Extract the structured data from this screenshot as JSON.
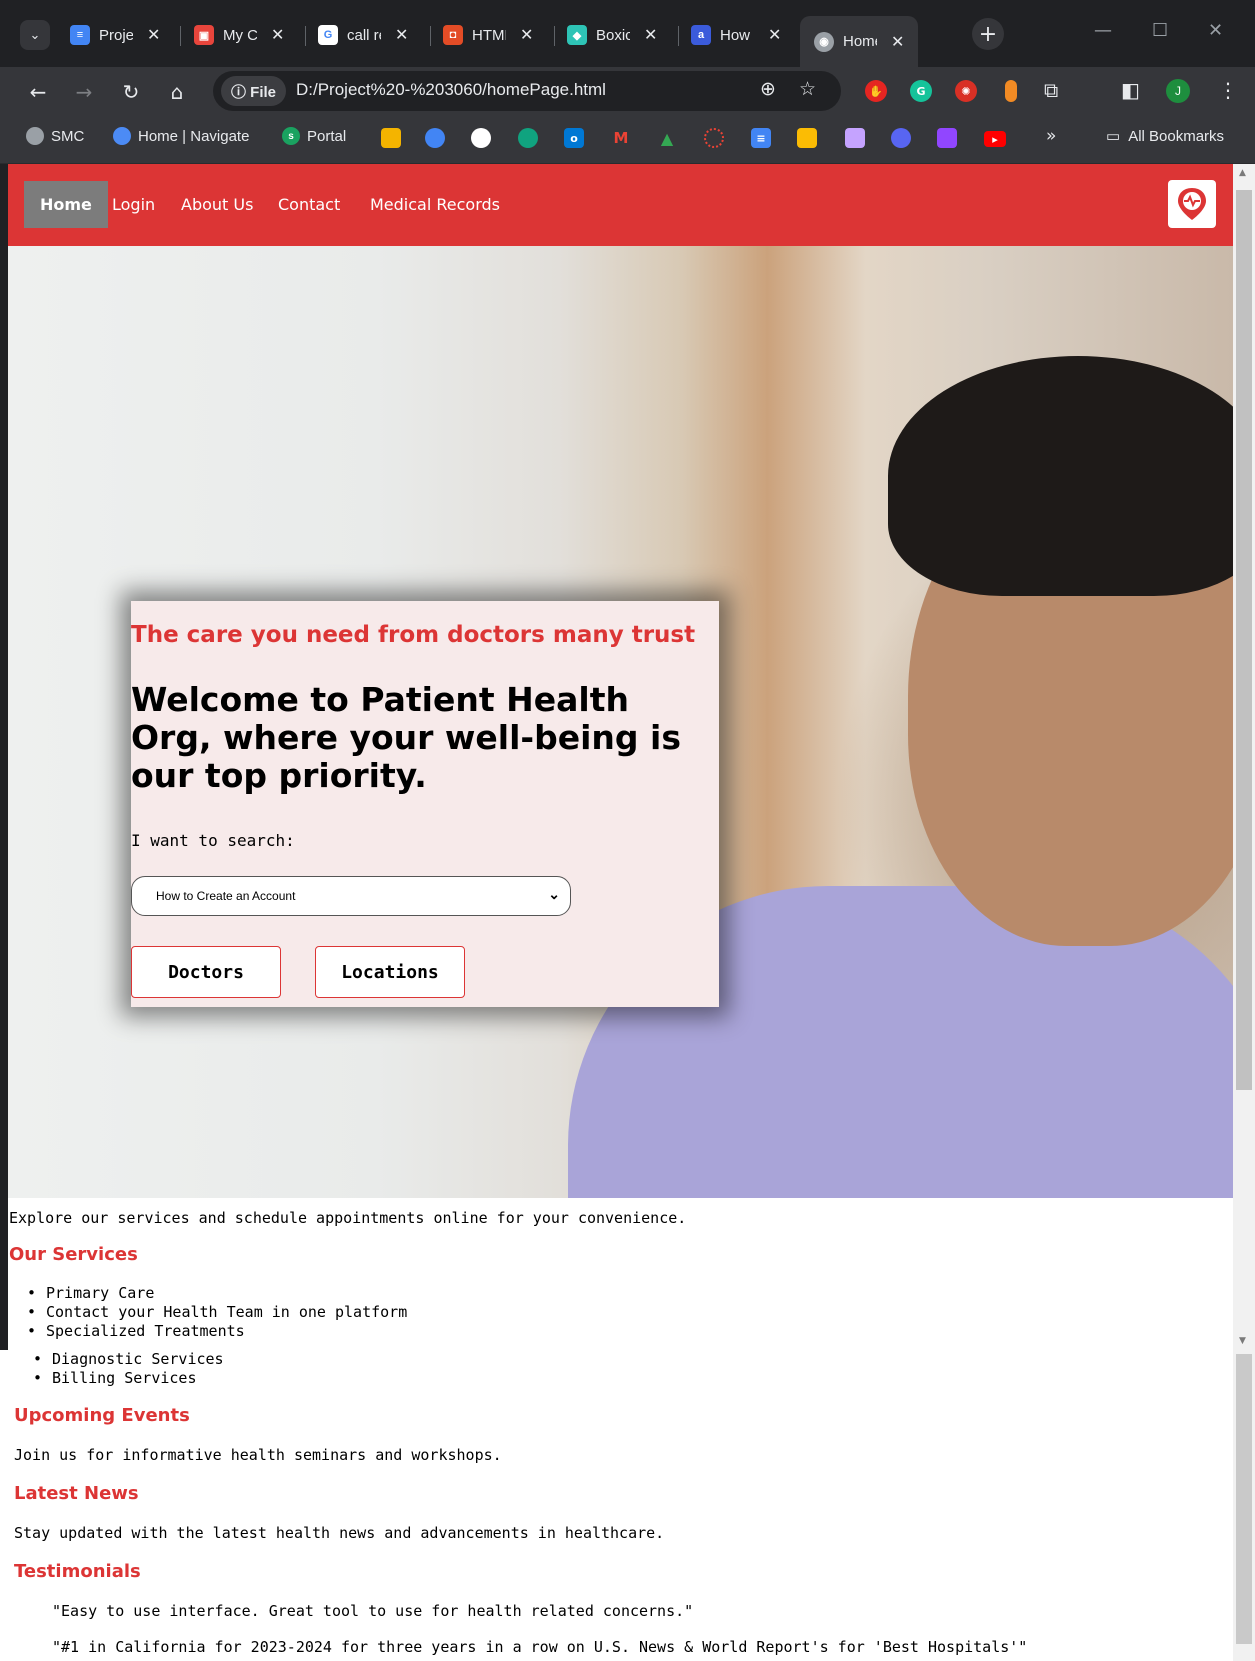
{
  "browser": {
    "tabs": [
      {
        "title": "Project",
        "color": "#4285f4",
        "glyph": "≡"
      },
      {
        "title": "My Cal",
        "color": "#e8453c",
        "glyph": "▣"
      },
      {
        "title": "call re",
        "color": "#ffffff",
        "glyph": "G"
      },
      {
        "title": "HTML",
        "color": "#e34c26",
        "glyph": "◘"
      },
      {
        "title": "Boxicons",
        "color": "#2ec4b6",
        "glyph": "◆"
      },
      {
        "title": "How t",
        "color": "#3b5bdb",
        "glyph": "a"
      },
      {
        "title": "Home",
        "color": "#9aa0a6",
        "glyph": "◉"
      }
    ],
    "active_tab_index": 6,
    "url_chip": "ⓘ File",
    "url": "D:/Project%20-%203060/homePage.html",
    "profile_initial": "J",
    "bookmarks": [
      {
        "label": "SMC",
        "color": "#9aa0a6"
      },
      {
        "label": "Home | Navigate",
        "color": "#4c8bf5"
      },
      {
        "label": "Portal",
        "color": "#1aa260"
      }
    ],
    "bookmark_icons": [
      "#f4b400",
      "#4285f4",
      "#ffffff",
      "#10a37f",
      "#0078d4",
      "#ea4335",
      "#34a853",
      "#ea4335",
      "#4285f4",
      "#fbbc04",
      "#c5a3ff",
      "#5865f2",
      "#9146ff",
      "#ff0000"
    ],
    "all_bookmarks_label": "All Bookmarks"
  },
  "nav": {
    "items": [
      "Home",
      "Login",
      "About Us",
      "Contact",
      "Medical Records"
    ],
    "active": "Home"
  },
  "hero": {
    "tagline": "The care you need from doctors many trust",
    "title": "Welcome to Patient Health Org, where your well-being is our top priority.",
    "search_label": "I want to search:",
    "search_selected": "How to Create an Account",
    "doctors_button": "Doctors",
    "locations_button": "Locations"
  },
  "content": {
    "intro": "Explore our services and schedule appointments online for your convenience.",
    "services_heading": "Our Services",
    "services": [
      "Primary Care",
      "Contact your Health Team in one platform",
      "Specialized Treatments"
    ],
    "services_continued": [
      "Diagnostic Services",
      "Billing Services"
    ],
    "events_heading": "Upcoming Events",
    "events_text": "Join us for informative health seminars and workshops.",
    "news_heading": "Latest News",
    "news_text": "Stay updated with the latest health news and advancements in healthcare.",
    "testimonials_heading": "Testimonials",
    "testimonials": [
      "\"Easy to use interface. Great tool to use for health related concerns.\"",
      "\"#1 in California for 2023-2024 for three years in a row on U.S. News & World Report's for 'Best Hospitals'\""
    ]
  },
  "colors": {
    "brand_red": "#dc3535",
    "nav_active": "#7c7c7c",
    "card_bg": "#f7eaea"
  }
}
